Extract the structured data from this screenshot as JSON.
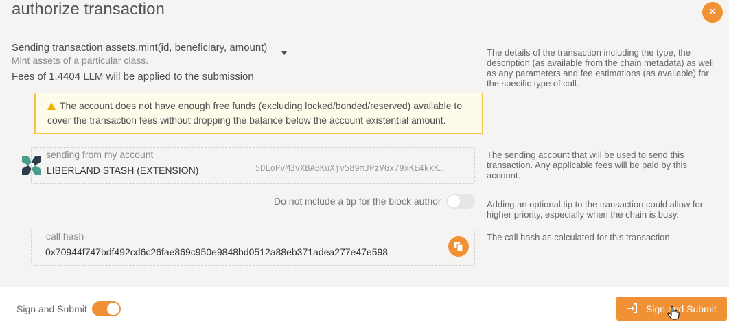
{
  "modal": {
    "title": "authorize transaction",
    "close_icon": "✕"
  },
  "transaction": {
    "summary": "Sending transaction assets.mint(id, beneficiary, amount)",
    "description": "Mint assets of a particular class.",
    "fees": "Fees of 1.4404 LLM will be applied to the submission",
    "help": "The details of the transaction including the type, the description (as available from the chain metadata) as well as any parameters and fee estimations (as available) for the specific type of call."
  },
  "warning": {
    "text": "The account does not have enough free funds (excluding locked/bonded/reserved) available to cover the transaction fees without dropping the balance below the account existential amount."
  },
  "account": {
    "label": "sending from my account",
    "name": "LIBERLAND STASH (EXTENSION)",
    "address": "5DLoPvM3vXBABKuXjv589mJPzVGx79xKE4kkK…",
    "help": "The sending account that will be used to send this transaction. Any applicable fees will be paid by this account."
  },
  "tip": {
    "label": "Do not include a tip for the block author",
    "enabled": false,
    "help": "Adding an optional tip to the transaction could allow for higher priority, especially when the chain is busy."
  },
  "call_hash": {
    "label": "call hash",
    "value": "0x70944f747bdf492cd6c26fae869c950e9848bd0512a88eb371adea277e47e598",
    "help": "The call hash as calculated for this transaction"
  },
  "footer": {
    "toggle_label": "Sign and Submit",
    "toggle_on": true,
    "submit_label": "Sign and Submit"
  },
  "colors": {
    "accent": "#f19135",
    "warning_border": "#f5c24a",
    "warning_bg": "#fffbeb"
  }
}
